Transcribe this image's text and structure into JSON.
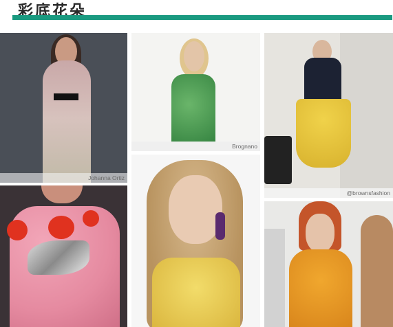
{
  "page": {
    "title": "彩底花朵"
  },
  "photos": [
    {
      "caption": "Johanna Ortiz"
    },
    {
      "caption": "Brognano"
    },
    {
      "caption": "@brownsfashion"
    },
    {
      "caption": ""
    },
    {
      "caption": ""
    },
    {
      "caption": ""
    }
  ],
  "colors": {
    "accent_bar": "#1a9a80",
    "title_text": "#2a2a2a"
  }
}
